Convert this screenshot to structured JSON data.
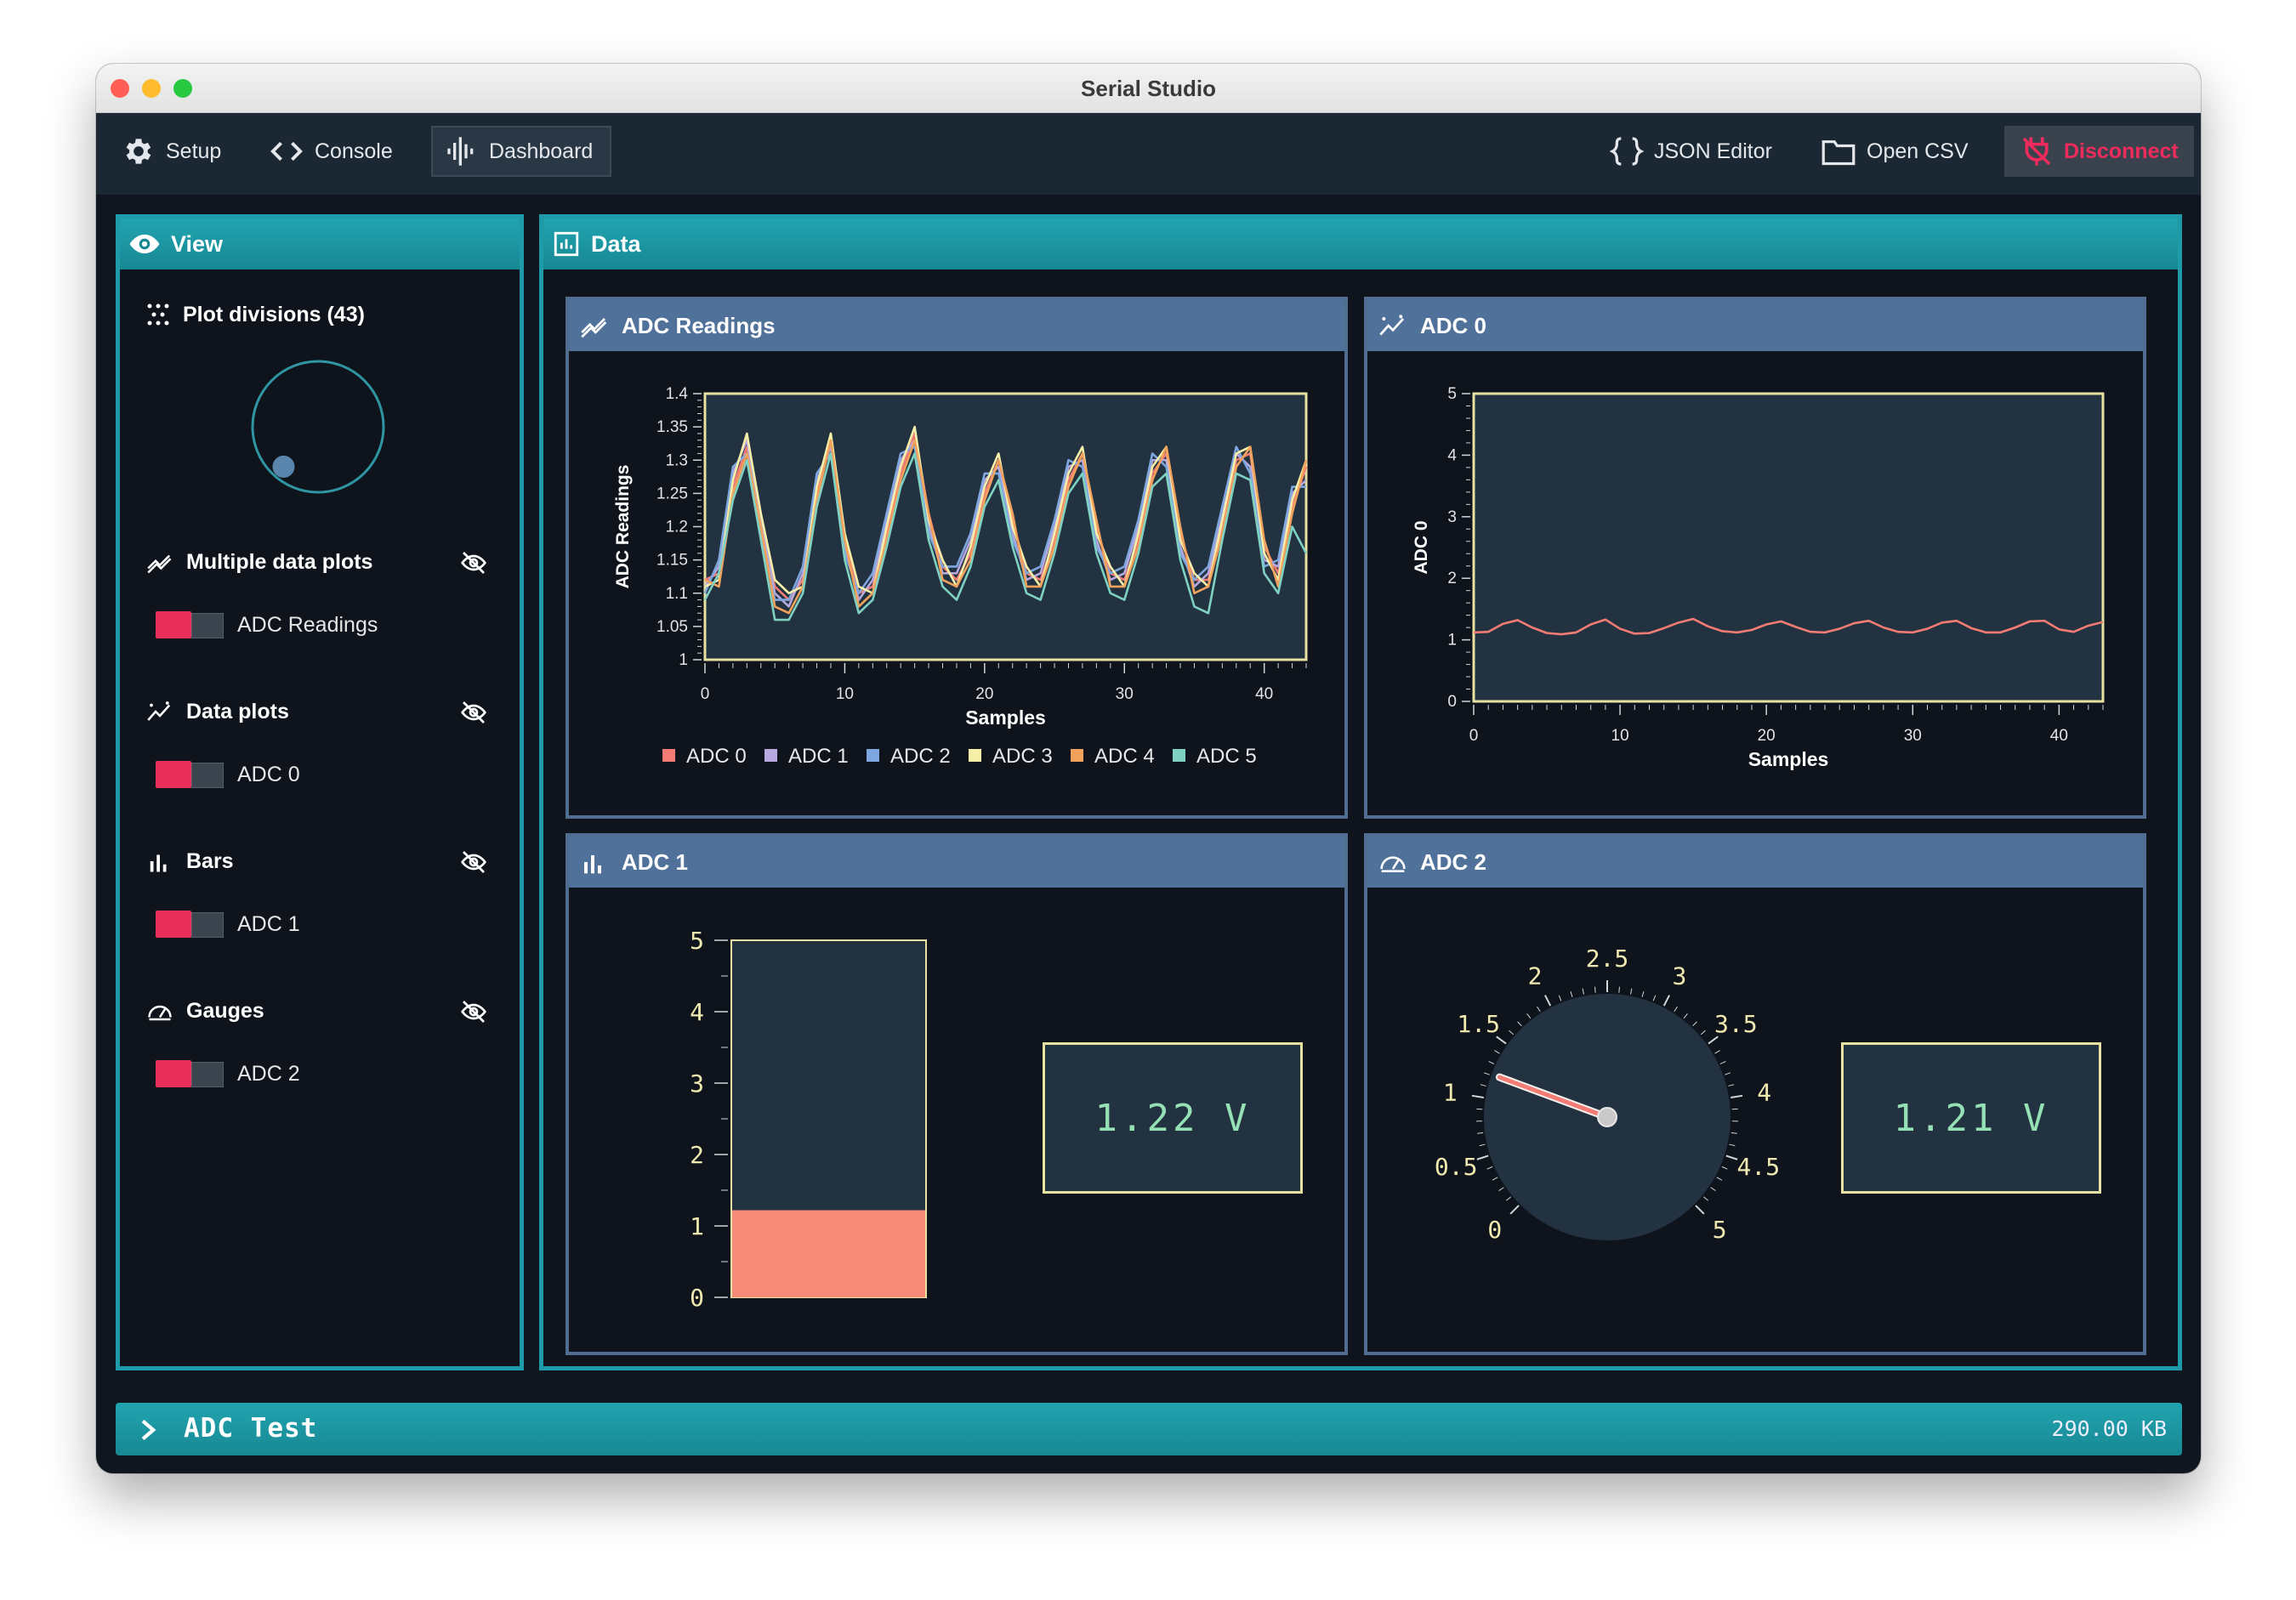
{
  "window": {
    "title": "Serial Studio"
  },
  "toolbar": {
    "setup": "Setup",
    "console": "Console",
    "dashboard": "Dashboard",
    "json_editor": "JSON Editor",
    "open_csv": "Open CSV",
    "disconnect": "Disconnect"
  },
  "view": {
    "title": "View",
    "plot_divisions": "Plot divisions (43)",
    "knob_value_fraction": 0.02,
    "groups": [
      {
        "title": "Multiple data plots",
        "icon": "multiplot-icon",
        "items": [
          "ADC Readings"
        ]
      },
      {
        "title": "Data plots",
        "icon": "plot-icon",
        "items": [
          "ADC 0"
        ]
      },
      {
        "title": "Bars",
        "icon": "bars-icon",
        "items": [
          "ADC 1"
        ]
      },
      {
        "title": "Gauges",
        "icon": "gauge-icon",
        "items": [
          "ADC 2"
        ]
      }
    ]
  },
  "data_panel": {
    "title": "Data"
  },
  "widgets": {
    "adc_readings": {
      "title": "ADC Readings"
    },
    "adc0": {
      "title": "ADC 0"
    },
    "adc1": {
      "title": "ADC 1",
      "value_text": "1.22 V",
      "value": 1.22,
      "min": 0,
      "max": 5,
      "ticks": [
        "0",
        "1",
        "2",
        "3",
        "4",
        "5"
      ]
    },
    "adc2": {
      "title": "ADC 2",
      "value_text": "1.21 V",
      "value": 1.21,
      "min": 0,
      "max": 5,
      "ticks": [
        "0",
        "0.5",
        "1",
        "1.5",
        "2",
        "2.5",
        "3",
        "3.5",
        "4",
        "4.5",
        "5"
      ]
    }
  },
  "status": {
    "project": "ADC Test",
    "size": "290.00 KB"
  },
  "colors": {
    "accent": "#1f9aa8",
    "widget_header": "#50729a",
    "disconnect": "#ee2b5c",
    "plot_bg": "#223240",
    "plot_frame": "#e7e1a2"
  },
  "chart_data": [
    {
      "type": "line",
      "title": "ADC Readings",
      "xlabel": "Samples",
      "ylabel": "ADC Readings",
      "xlim": [
        0,
        43
      ],
      "ylim": [
        1,
        1.4
      ],
      "xticks": [
        "0",
        "10",
        "20",
        "30",
        "40"
      ],
      "yticks": [
        "1",
        "1.05",
        "1.1",
        "1.15",
        "1.2",
        "1.25",
        "1.3",
        "1.35",
        "1.4"
      ],
      "legend": "bottom",
      "x": [
        0,
        1,
        2,
        3,
        4,
        5,
        6,
        7,
        8,
        9,
        10,
        11,
        12,
        13,
        14,
        15,
        16,
        17,
        18,
        19,
        20,
        21,
        22,
        23,
        24,
        25,
        26,
        27,
        28,
        29,
        30,
        31,
        32,
        33,
        34,
        35,
        36,
        37,
        38,
        39,
        40,
        41,
        42,
        43
      ],
      "series": [
        {
          "name": "ADC 0",
          "color": "#f47c74",
          "values": [
            1.12,
            1.13,
            1.26,
            1.32,
            1.2,
            1.11,
            1.09,
            1.12,
            1.25,
            1.33,
            1.18,
            1.1,
            1.11,
            1.19,
            1.28,
            1.34,
            1.22,
            1.14,
            1.12,
            1.16,
            1.25,
            1.3,
            1.21,
            1.13,
            1.12,
            1.18,
            1.27,
            1.31,
            1.2,
            1.13,
            1.12,
            1.18,
            1.28,
            1.31,
            1.19,
            1.12,
            1.12,
            1.2,
            1.3,
            1.31,
            1.17,
            1.13,
            1.23,
            1.29
          ]
        },
        {
          "name": "ADC 1",
          "color": "#b7a8e0",
          "values": [
            1.11,
            1.14,
            1.28,
            1.33,
            1.21,
            1.1,
            1.08,
            1.13,
            1.27,
            1.32,
            1.17,
            1.09,
            1.12,
            1.21,
            1.3,
            1.33,
            1.2,
            1.13,
            1.13,
            1.18,
            1.27,
            1.29,
            1.19,
            1.12,
            1.13,
            1.2,
            1.29,
            1.3,
            1.18,
            1.12,
            1.13,
            1.2,
            1.3,
            1.3,
            1.17,
            1.11,
            1.13,
            1.22,
            1.31,
            1.29,
            1.15,
            1.14,
            1.25,
            1.27
          ]
        },
        {
          "name": "ADC 2",
          "color": "#7fa7df",
          "values": [
            1.1,
            1.15,
            1.29,
            1.31,
            1.19,
            1.09,
            1.09,
            1.14,
            1.28,
            1.31,
            1.16,
            1.1,
            1.13,
            1.22,
            1.31,
            1.32,
            1.19,
            1.14,
            1.14,
            1.19,
            1.28,
            1.28,
            1.18,
            1.13,
            1.14,
            1.21,
            1.3,
            1.29,
            1.17,
            1.13,
            1.14,
            1.21,
            1.31,
            1.29,
            1.16,
            1.12,
            1.14,
            1.23,
            1.32,
            1.28,
            1.14,
            1.15,
            1.26,
            1.26
          ]
        },
        {
          "name": "ADC 3",
          "color": "#f6efa8",
          "values": [
            1.11,
            1.12,
            1.27,
            1.34,
            1.22,
            1.12,
            1.1,
            1.11,
            1.26,
            1.34,
            1.19,
            1.11,
            1.1,
            1.2,
            1.29,
            1.35,
            1.21,
            1.15,
            1.11,
            1.17,
            1.26,
            1.31,
            1.2,
            1.14,
            1.11,
            1.19,
            1.28,
            1.32,
            1.19,
            1.14,
            1.11,
            1.19,
            1.29,
            1.32,
            1.18,
            1.13,
            1.11,
            1.21,
            1.31,
            1.32,
            1.16,
            1.12,
            1.24,
            1.3
          ]
        },
        {
          "name": "ADC 4",
          "color": "#f3a25c",
          "values": [
            1.12,
            1.11,
            1.25,
            1.31,
            1.2,
            1.08,
            1.07,
            1.11,
            1.24,
            1.33,
            1.18,
            1.08,
            1.1,
            1.18,
            1.27,
            1.33,
            1.22,
            1.12,
            1.11,
            1.15,
            1.24,
            1.3,
            1.22,
            1.11,
            1.11,
            1.17,
            1.26,
            1.31,
            1.21,
            1.11,
            1.11,
            1.17,
            1.27,
            1.32,
            1.2,
            1.1,
            1.11,
            1.19,
            1.29,
            1.32,
            1.18,
            1.11,
            1.22,
            1.3
          ]
        },
        {
          "name": "ADC 5",
          "color": "#7fd1c2",
          "values": [
            1.09,
            1.13,
            1.24,
            1.3,
            1.18,
            1.06,
            1.06,
            1.1,
            1.23,
            1.31,
            1.15,
            1.07,
            1.09,
            1.17,
            1.26,
            1.31,
            1.18,
            1.11,
            1.09,
            1.14,
            1.23,
            1.27,
            1.17,
            1.1,
            1.09,
            1.16,
            1.25,
            1.28,
            1.16,
            1.1,
            1.09,
            1.16,
            1.26,
            1.28,
            1.15,
            1.08,
            1.07,
            1.18,
            1.28,
            1.27,
            1.13,
            1.1,
            1.2,
            1.16
          ]
        }
      ]
    },
    {
      "type": "line",
      "title": "ADC 0",
      "xlabel": "Samples",
      "ylabel": "ADC 0",
      "xlim": [
        0,
        43
      ],
      "ylim": [
        0,
        5
      ],
      "xticks": [
        "0",
        "10",
        "20",
        "30",
        "40"
      ],
      "yticks": [
        "0",
        "1",
        "2",
        "3",
        "4",
        "5"
      ],
      "series": [
        {
          "name": "ADC 0",
          "color": "#f47c74",
          "values": [
            1.12,
            1.13,
            1.26,
            1.32,
            1.2,
            1.11,
            1.09,
            1.12,
            1.25,
            1.33,
            1.18,
            1.1,
            1.11,
            1.19,
            1.28,
            1.34,
            1.22,
            1.14,
            1.12,
            1.16,
            1.25,
            1.3,
            1.21,
            1.13,
            1.12,
            1.18,
            1.27,
            1.31,
            1.2,
            1.13,
            1.12,
            1.18,
            1.28,
            1.31,
            1.19,
            1.12,
            1.12,
            1.2,
            1.3,
            1.31,
            1.17,
            1.13,
            1.23,
            1.29
          ]
        }
      ]
    }
  ]
}
